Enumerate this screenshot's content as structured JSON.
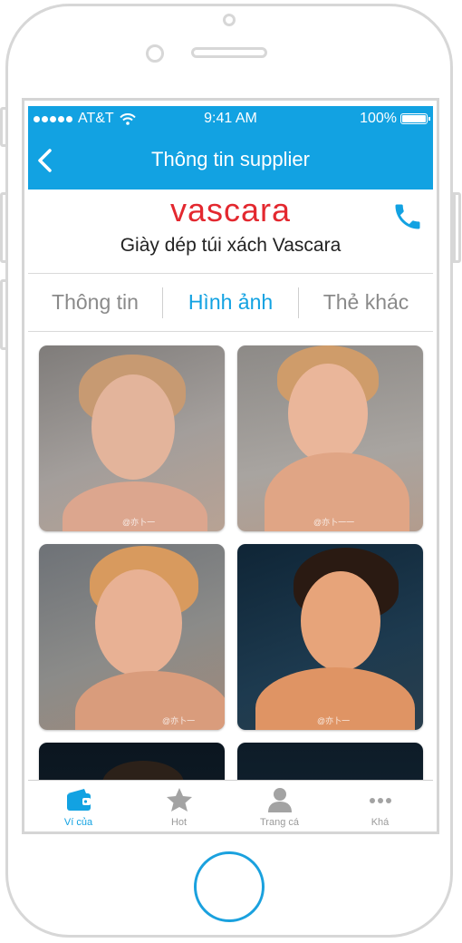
{
  "status_bar": {
    "carrier": "AT&T",
    "time": "9:41 AM",
    "battery": "100%"
  },
  "nav": {
    "title": "Thông tin supplier",
    "back_icon": "chevron-left-icon"
  },
  "brand": {
    "logo_text": "vascara",
    "name": "Giày dép túi xách Vascara",
    "call_icon": "phone-icon"
  },
  "tabs": [
    {
      "label": "Thông tin",
      "active": false
    },
    {
      "label": "Hình ảnh",
      "active": true
    },
    {
      "label": "Thẻ khác",
      "active": false
    }
  ],
  "photos": [
    {
      "watermark": "@亦卜一"
    },
    {
      "watermark": "@亦卜一一"
    },
    {
      "watermark": "@亦卜一"
    },
    {
      "watermark": "@亦卜一"
    },
    {
      "watermark": ""
    },
    {
      "watermark": ""
    }
  ],
  "tab_bar": [
    {
      "label": "Ví của",
      "icon": "wallet-icon",
      "active": true
    },
    {
      "label": "Hot",
      "icon": "star-icon",
      "active": false
    },
    {
      "label": "Trang cá",
      "icon": "person-icon",
      "active": false
    },
    {
      "label": "Khá",
      "icon": "more-icon",
      "active": false
    }
  ],
  "colors": {
    "accent": "#12a2e2",
    "brand_red": "#e3282f",
    "home_ring": "#1aa1de"
  }
}
